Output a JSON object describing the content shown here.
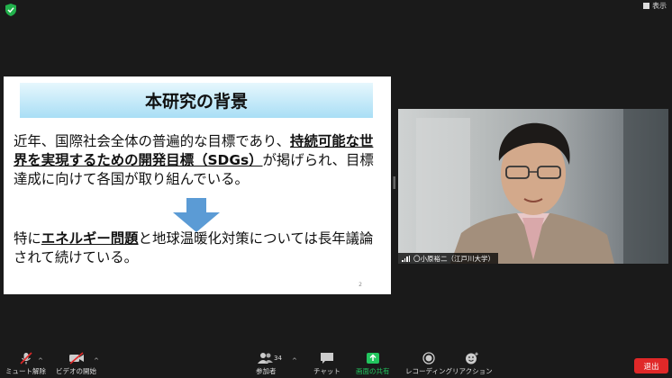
{
  "topbar": {
    "view_label": "表示"
  },
  "slide": {
    "title": "本研究の背景",
    "para1": {
      "p1": "近年、国際社会全体の普遍的な目標であり、",
      "u1": "持続可能な世界を実現するための開発目標（SDGs）",
      "p2": "が掲げられ、目標達成に向けて各国が取り組んでいる。"
    },
    "para2": {
      "p1": "特に",
      "u1": "エネルギー問題",
      "p2": "と地球温暖化対策については長年議論されて続けている。"
    },
    "page_number": "2",
    "arrow_color": "#5b9bd5"
  },
  "video": {
    "name": "〇小原裕二（江戸川大学）"
  },
  "toolbar": {
    "mute": "ミュート解除",
    "video": "ビデオの開始",
    "participants": "参加者",
    "participants_count": "34",
    "chat": "チャット",
    "share": "画面の共有",
    "record": "レコーディング",
    "reactions": "リアクション",
    "leave": "退出",
    "share_color": "#22c55e",
    "leave_color": "#e02828"
  }
}
